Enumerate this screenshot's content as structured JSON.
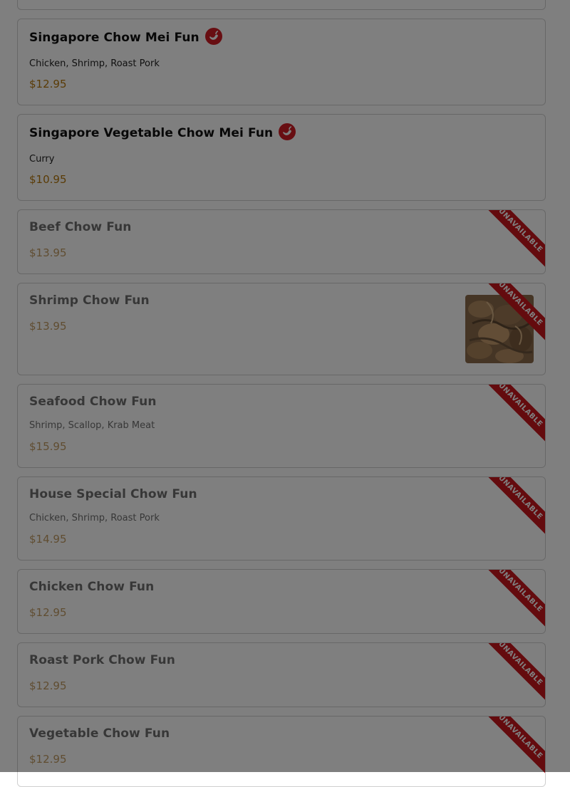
{
  "items": [
    {
      "name": "Singapore Chow Mei Fun",
      "spicy": true,
      "desc": "Chicken, Shrimp, Roast Pork",
      "price": "$12.95"
    },
    {
      "name": "Singapore Vegetable Chow Mei Fun",
      "spicy": true,
      "desc": "Curry",
      "price": "$10.95"
    },
    {
      "name": "Beef Chow Fun",
      "price": "$13.95",
      "badge": "UNAVAILABLE"
    },
    {
      "name": "Shrimp Chow Fun",
      "price": "$13.95",
      "badge": "UNAVAILABLE",
      "has_image": true
    },
    {
      "name": "Seafood Chow Fun",
      "desc": "Shrimp, Scallop, Krab Meat",
      "price": "$15.95",
      "badge": "UNAVAILABLE"
    },
    {
      "name": "House Special Chow Fun",
      "desc": "Chicken, Shrimp, Roast Pork",
      "price": "$14.95",
      "badge": "UNAVAILABLE"
    },
    {
      "name": "Chicken Chow Fun",
      "price": "$12.95",
      "badge": "UNAVAILABLE"
    },
    {
      "name": "Roast Pork Chow Fun",
      "price": "$12.95",
      "badge": "UNAVAILABLE"
    },
    {
      "name": "Vegetable Chow Fun",
      "price": "$12.95",
      "badge": "UNAVAILABLE"
    }
  ],
  "colors": {
    "accent_price": "#b5770c",
    "ribbon": "#c8161d",
    "spicy_icon": "#d01c24",
    "overlay": "rgba(0,0,0,0.5)"
  },
  "icons": {
    "spicy": "chili-pepper-icon"
  }
}
